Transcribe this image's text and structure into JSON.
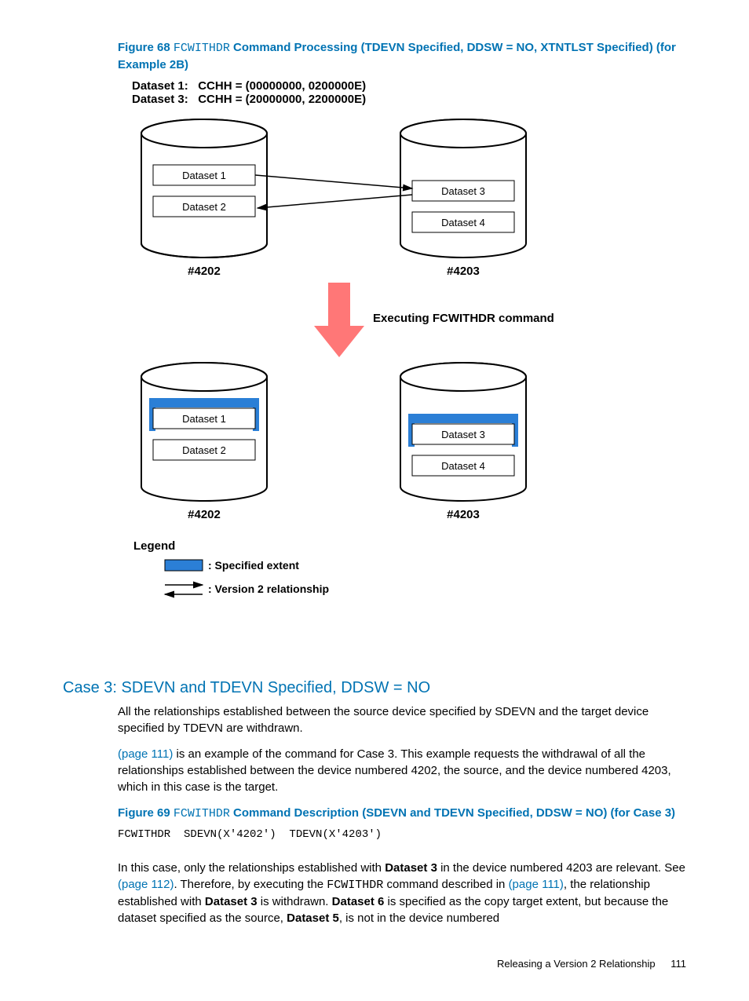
{
  "figure68": {
    "label": "Figure 68",
    "code": "FCWITHDR",
    "rest": " Command Processing (TDEVN Specified, DDSW = NO, XTNTLST Specified) (for Example 2B)"
  },
  "cchh": {
    "d1_label": "Dataset 1:",
    "d1_val": "CCHH = (00000000, 0200000E)",
    "d3_label": "Dataset 3:",
    "d3_val": "CCHH = (20000000, 2200000E)"
  },
  "diagram": {
    "ds1": "Dataset 1",
    "ds2": "Dataset 2",
    "ds3": "Dataset 3",
    "ds4": "Dataset 4",
    "dev_left": "#4202",
    "dev_right": "#4203",
    "exec": "Executing FCWITHDR command",
    "legend_title": "Legend",
    "legend_spec": ": Specified extent",
    "legend_v2": ": Version 2 relationship"
  },
  "case3": {
    "heading": "Case 3: SDEVN and TDEVN Specified, DDSW = NO",
    "p1": "All the relationships established between the source device specified by SDEVN and the target device specified by TDEVN are withdrawn.",
    "link1": "(page 111)",
    "p2_rest": " is an example of the command for Case 3. This example requests the withdrawal of all the relationships established between the device numbered 4202, the source, and the device numbered 4203, which in this case is the target."
  },
  "figure69": {
    "label": "Figure 69",
    "code": "FCWITHDR",
    "rest": " Command Description (SDEVN and TDEVN Specified, DDSW = NO) (for Case 3)",
    "command": "FCWITHDR  SDEVN(X'4202')  TDEVN(X'4203')"
  },
  "p3": {
    "a": "In this case, only the relationships established with ",
    "b_ds3": "Dataset 3",
    "c": " in the device numbered 4203 are relevant. See ",
    "link2": "(page 112)",
    "d": ". Therefore, by executing the ",
    "code": "FCWITHDR",
    "e": " command described in ",
    "link3": "(page 111)",
    "f": ", the relationship established with ",
    "b_ds3b": "Dataset 3",
    "g": " is withdrawn. ",
    "b_ds6": "Dataset 6",
    "h": " is specified as the copy target extent, but because the dataset specified as the source, ",
    "b_ds5": "Dataset 5",
    "i": ", is not in the device numbered"
  },
  "footer": {
    "text": "Releasing a Version 2 Relationship",
    "page": "111"
  }
}
